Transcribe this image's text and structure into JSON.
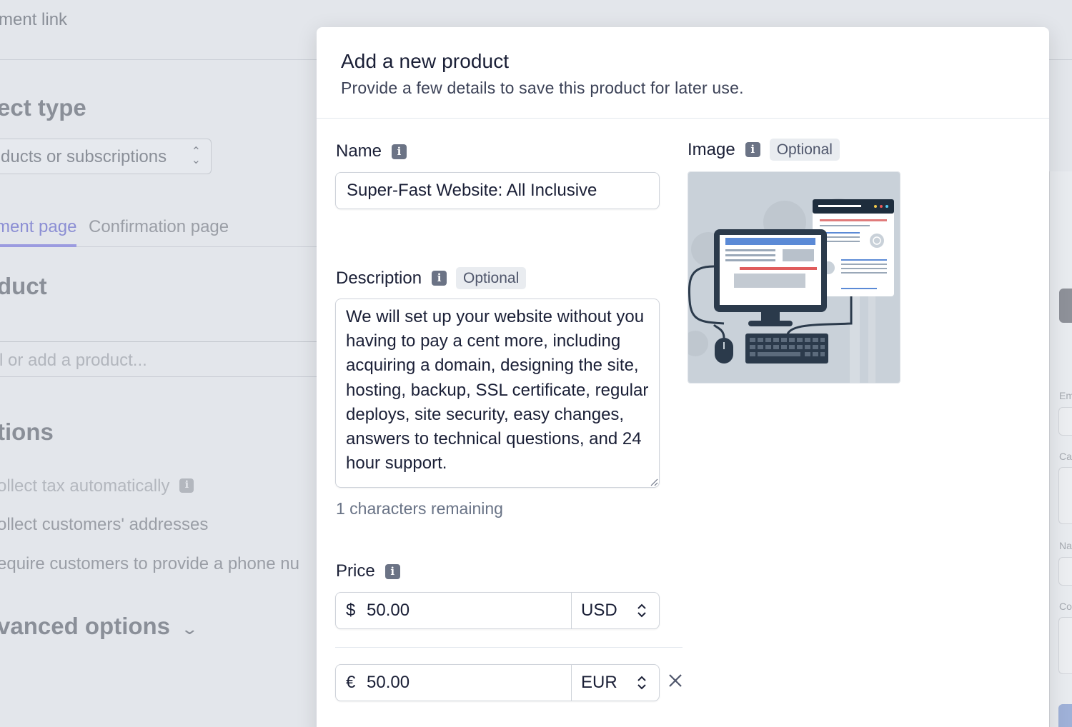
{
  "background": {
    "page_title": "ment link",
    "product_type_heading": "ect type",
    "product_type_select": "ducts or subscriptions",
    "tabs": [
      "ment page",
      "Confirmation page"
    ],
    "product_heading": "duct",
    "product_search_placeholder": "l or add a product...",
    "options_heading": "tions",
    "options": [
      "ollect tax automatically",
      "ollect customers' addresses",
      "equire customers to provide a phone nu"
    ],
    "advanced_options": "vanced options",
    "right_panel_labels": [
      "Em",
      "Ca",
      "Na",
      "Co"
    ]
  },
  "modal": {
    "title": "Add a new product",
    "subtitle": "Provide a few details to save this product for later use.",
    "name": {
      "label": "Name",
      "value": "Super-Fast Website: All Inclusive"
    },
    "description": {
      "label": "Description",
      "badge": "Optional",
      "value": "We will set up your website without you having to pay a cent more, including acquiring a domain, designing the site, hosting, backup, SSL certificate, regular deploys, site security, easy changes, answers to technical questions, and 24 hour support.",
      "remaining": "1 characters remaining"
    },
    "image": {
      "label": "Image",
      "badge": "Optional",
      "icon": "website-illustration"
    },
    "price": {
      "label": "Price",
      "rows": [
        {
          "symbol": "$",
          "amount": "50.00",
          "currency": "USD"
        },
        {
          "symbol": "€",
          "amount": "50.00",
          "currency": "EUR"
        }
      ]
    }
  },
  "colors": {
    "accent": "#635bff",
    "text": "#1a1f36",
    "muted": "#697386"
  }
}
